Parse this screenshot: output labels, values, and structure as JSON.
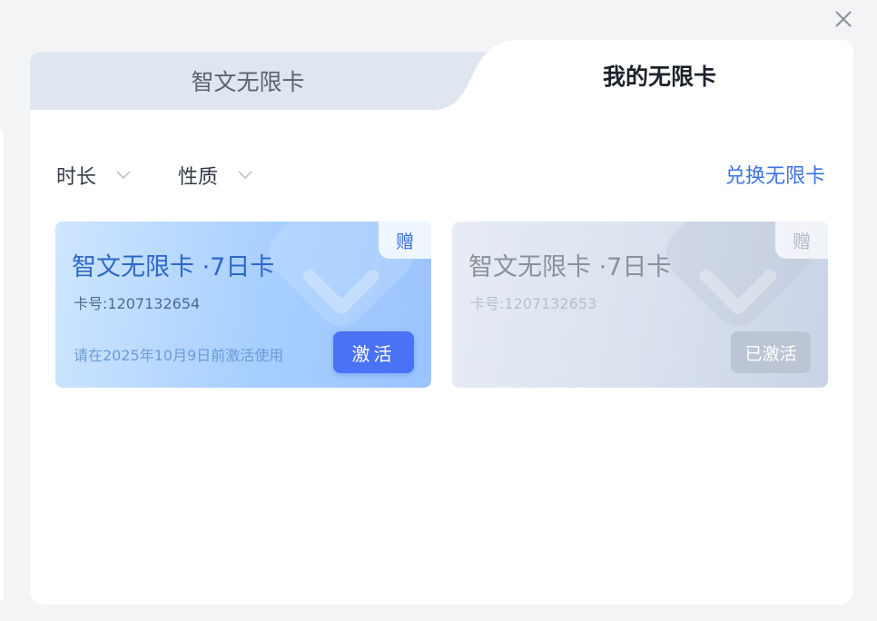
{
  "tabs": {
    "unlimited_card": "智文无限卡",
    "my_unlimited_card": "我的无限卡"
  },
  "filters": {
    "duration": "时长",
    "nature": "性质"
  },
  "redeem_link": "兑换无限卡",
  "cards": [
    {
      "title": "智文无限卡 ·7日卡",
      "badge": "赠",
      "number": "卡号:1207132654",
      "note": "请在2025年10月9日前激活使用",
      "button": "激活",
      "status": "inactive"
    },
    {
      "title": "智文无限卡 ·7日卡",
      "badge": "赠",
      "number": "卡号:1207132653",
      "button": "已激活",
      "status": "activated"
    }
  ],
  "colors": {
    "accent": "#4a72f5",
    "link": "#3b73e8",
    "activated_button": "#bcc5d4"
  }
}
